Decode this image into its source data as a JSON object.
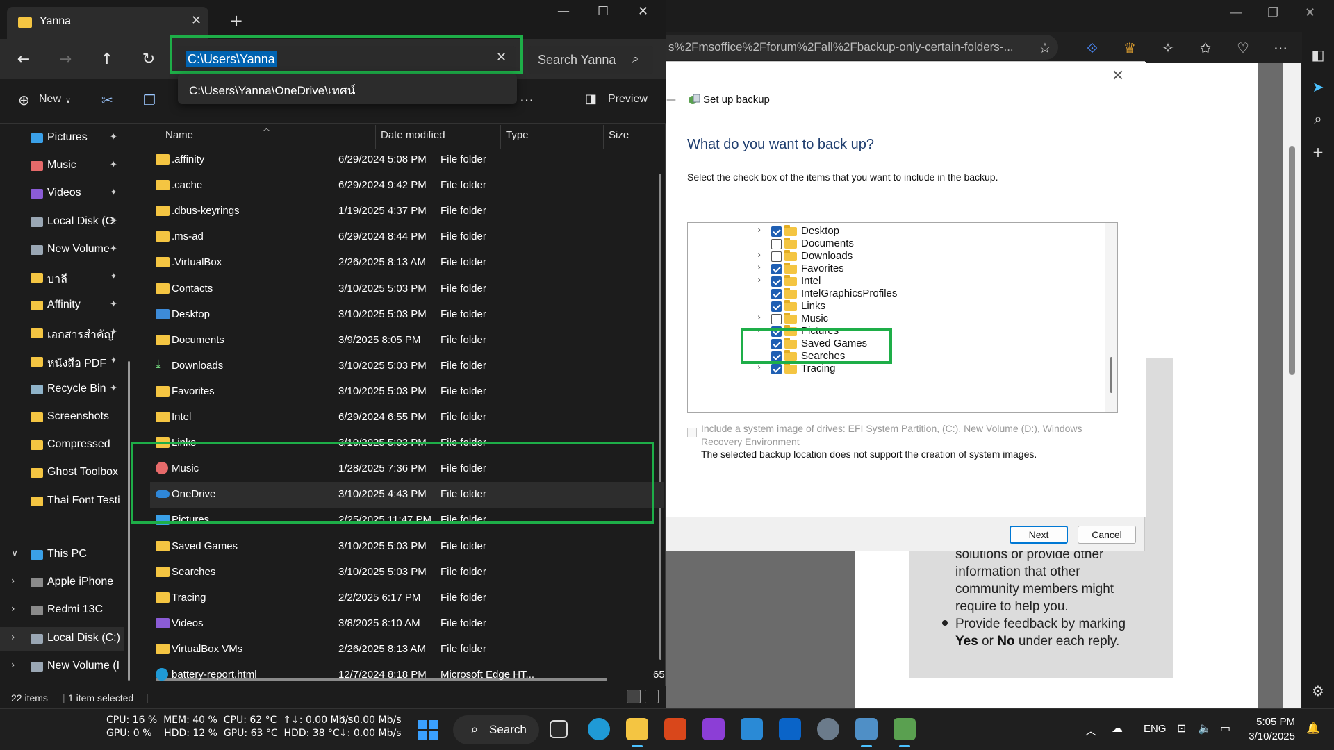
{
  "browser": {
    "url_fragment": "s%2Fmsoffice%2Fforum%2Fall%2Fbackup-only-certain-folders-...",
    "card_lines": [
      "solutions or provide other",
      "information that other",
      "community members might",
      "require to help you."
    ],
    "card_bullet_prefix": "Provide feedback by marking",
    "card_bullet_yes": "Yes",
    "card_bullet_or": "or",
    "card_bullet_no": "No",
    "card_bullet_suffix": "under each reply."
  },
  "dialog": {
    "title": "Set up backup",
    "heading": "What do you want to back up?",
    "description": "Select the check box of the items that you want to include in the backup.",
    "tree": [
      {
        "label": "Desktop",
        "checked": true,
        "expandable": true
      },
      {
        "label": "Documents",
        "checked": false,
        "expandable": false
      },
      {
        "label": "Downloads",
        "checked": false,
        "expandable": true
      },
      {
        "label": "Favorites",
        "checked": true,
        "expandable": true
      },
      {
        "label": "Intel",
        "checked": true,
        "expandable": true
      },
      {
        "label": "IntelGraphicsProfiles",
        "checked": true,
        "expandable": false
      },
      {
        "label": "Links",
        "checked": true,
        "expandable": false
      },
      {
        "label": "Music",
        "checked": false,
        "expandable": true
      },
      {
        "label": "Pictures",
        "checked": true,
        "expandable": true
      },
      {
        "label": "Saved Games",
        "checked": true,
        "expandable": false
      },
      {
        "label": "Searches",
        "checked": true,
        "expandable": false
      },
      {
        "label": "Tracing",
        "checked": true,
        "expandable": true
      }
    ],
    "system_image_label": "Include a system image of drives: EFI System Partition, (C:), New Volume (D:), Windows Recovery Environment",
    "system_image_note": "The selected backup location does not support the creation of system images.",
    "next_label": "Next",
    "cancel_label": "Cancel"
  },
  "explorer": {
    "tab_title": "Yanna",
    "address": "C:\\Users\\Yanna",
    "search_placeholder": "Search Yanna",
    "suggestion": "C:\\Users\\Yanna\\OneDrive\\เทศน์",
    "new_label": "New",
    "preview_label": "Preview",
    "columns": {
      "name": "Name",
      "date": "Date modified",
      "type": "Type",
      "size": "Size"
    },
    "sidebar": [
      {
        "label": "Pictures",
        "color": "#3aa0e8",
        "pinned": true
      },
      {
        "label": "Music",
        "color": "#e66a6a",
        "pinned": true
      },
      {
        "label": "Videos",
        "color": "#8b5cd6",
        "pinned": true
      },
      {
        "label": "Local Disk (C:",
        "color": "#9aa7b4",
        "pinned": true
      },
      {
        "label": "New Volume",
        "color": "#9aa7b4",
        "pinned": true
      },
      {
        "label": "บาลี",
        "color": "#f4c542",
        "pinned": true
      },
      {
        "label": "Affinity",
        "color": "#f4c542",
        "pinned": true
      },
      {
        "label": "เอกสารสำคัญ",
        "color": "#f4c542",
        "pinned": true
      },
      {
        "label": "หนังสือ PDF",
        "color": "#f4c542",
        "pinned": true
      },
      {
        "label": "Recycle Bin",
        "color": "#8fb3c9",
        "pinned": true
      },
      {
        "label": "Screenshots",
        "color": "#f4c542",
        "pinned": false
      },
      {
        "label": "Compressed",
        "color": "#f4c542",
        "pinned": false
      },
      {
        "label": "Ghost Toolbox",
        "color": "#f4c542",
        "pinned": false
      },
      {
        "label": "Thai Font Testing",
        "color": "#f4c542",
        "pinned": false
      }
    ],
    "sidebar_tree": [
      {
        "label": "This PC",
        "chev": "∨",
        "color": "#3aa0e8"
      },
      {
        "label": "Apple iPhone",
        "chev": "›",
        "color": "#8a8a8a"
      },
      {
        "label": "Redmi 13C",
        "chev": "›",
        "color": "#8a8a8a"
      },
      {
        "label": "Local Disk (C:)",
        "chev": "›",
        "color": "#9aa7b4"
      },
      {
        "label": "New Volume (I",
        "chev": "›",
        "color": "#9aa7b4"
      }
    ],
    "files": [
      {
        "name": ".affinity",
        "date": "6/29/2024 5:08 PM",
        "type": "File folder",
        "size": "",
        "icon": "folder"
      },
      {
        "name": ".cache",
        "date": "6/29/2024 9:42 PM",
        "type": "File folder",
        "size": "",
        "icon": "folder"
      },
      {
        "name": ".dbus-keyrings",
        "date": "1/19/2025 4:37 PM",
        "type": "File folder",
        "size": "",
        "icon": "folder"
      },
      {
        "name": ".ms-ad",
        "date": "6/29/2024 8:44 PM",
        "type": "File folder",
        "size": "",
        "icon": "folder"
      },
      {
        "name": ".VirtualBox",
        "date": "2/26/2025 8:13 AM",
        "type": "File folder",
        "size": "",
        "icon": "folder"
      },
      {
        "name": "Contacts",
        "date": "3/10/2025 5:03 PM",
        "type": "File folder",
        "size": "",
        "icon": "folder"
      },
      {
        "name": "Desktop",
        "date": "3/10/2025 5:03 PM",
        "type": "File folder",
        "size": "",
        "icon": "blue"
      },
      {
        "name": "Documents",
        "date": "3/9/2025 8:05 PM",
        "type": "File folder",
        "size": "",
        "icon": "folder"
      },
      {
        "name": "Downloads",
        "date": "3/10/2025 5:03 PM",
        "type": "File folder",
        "size": "",
        "icon": "dl"
      },
      {
        "name": "Favorites",
        "date": "3/10/2025 5:03 PM",
        "type": "File folder",
        "size": "",
        "icon": "folder"
      },
      {
        "name": "Intel",
        "date": "6/29/2024 6:55 PM",
        "type": "File folder",
        "size": "",
        "icon": "folder"
      },
      {
        "name": "Links",
        "date": "3/10/2025 5:03 PM",
        "type": "File folder",
        "size": "",
        "icon": "folder"
      },
      {
        "name": "Music",
        "date": "1/28/2025 7:36 PM",
        "type": "File folder",
        "size": "",
        "icon": "music"
      },
      {
        "name": "OneDrive",
        "date": "3/10/2025 4:43 PM",
        "type": "File folder",
        "size": "",
        "icon": "cloud"
      },
      {
        "name": "Pictures",
        "date": "2/25/2025 11:47 PM",
        "type": "File folder",
        "size": "",
        "icon": "pic"
      },
      {
        "name": "Saved Games",
        "date": "3/10/2025 5:03 PM",
        "type": "File folder",
        "size": "",
        "icon": "folder"
      },
      {
        "name": "Searches",
        "date": "3/10/2025 5:03 PM",
        "type": "File folder",
        "size": "",
        "icon": "folder"
      },
      {
        "name": "Tracing",
        "date": "2/2/2025 6:17 PM",
        "type": "File folder",
        "size": "",
        "icon": "folder"
      },
      {
        "name": "Videos",
        "date": "3/8/2025 8:10 AM",
        "type": "File folder",
        "size": "",
        "icon": "vid"
      },
      {
        "name": "VirtualBox VMs",
        "date": "2/26/2025 8:13 AM",
        "type": "File folder",
        "size": "",
        "icon": "folder"
      },
      {
        "name": "battery-report.html",
        "date": "12/7/2024 8:18 PM",
        "type": "Microsoft Edge HT...",
        "size": "65",
        "icon": "edge"
      }
    ],
    "status_items": "22 items",
    "status_selected": "1 item selected"
  },
  "taskbar": {
    "sysmon_line1": "CPU: 16 %  MEM: 40 %  CPU: 62 °C  ↑↓: 0.00 Mb/s",
    "sysmon_line2": "GPU: 0 %    HDD: 12 %  GPU: 63 °C  HDD: 38 °C",
    "net_up": "↑: 0.00 Mb/s",
    "net_down": "↓: 0.00 Mb/s",
    "search_label": "Search",
    "lang": "ENG",
    "time": "5:05 PM",
    "date": "3/10/2025"
  }
}
